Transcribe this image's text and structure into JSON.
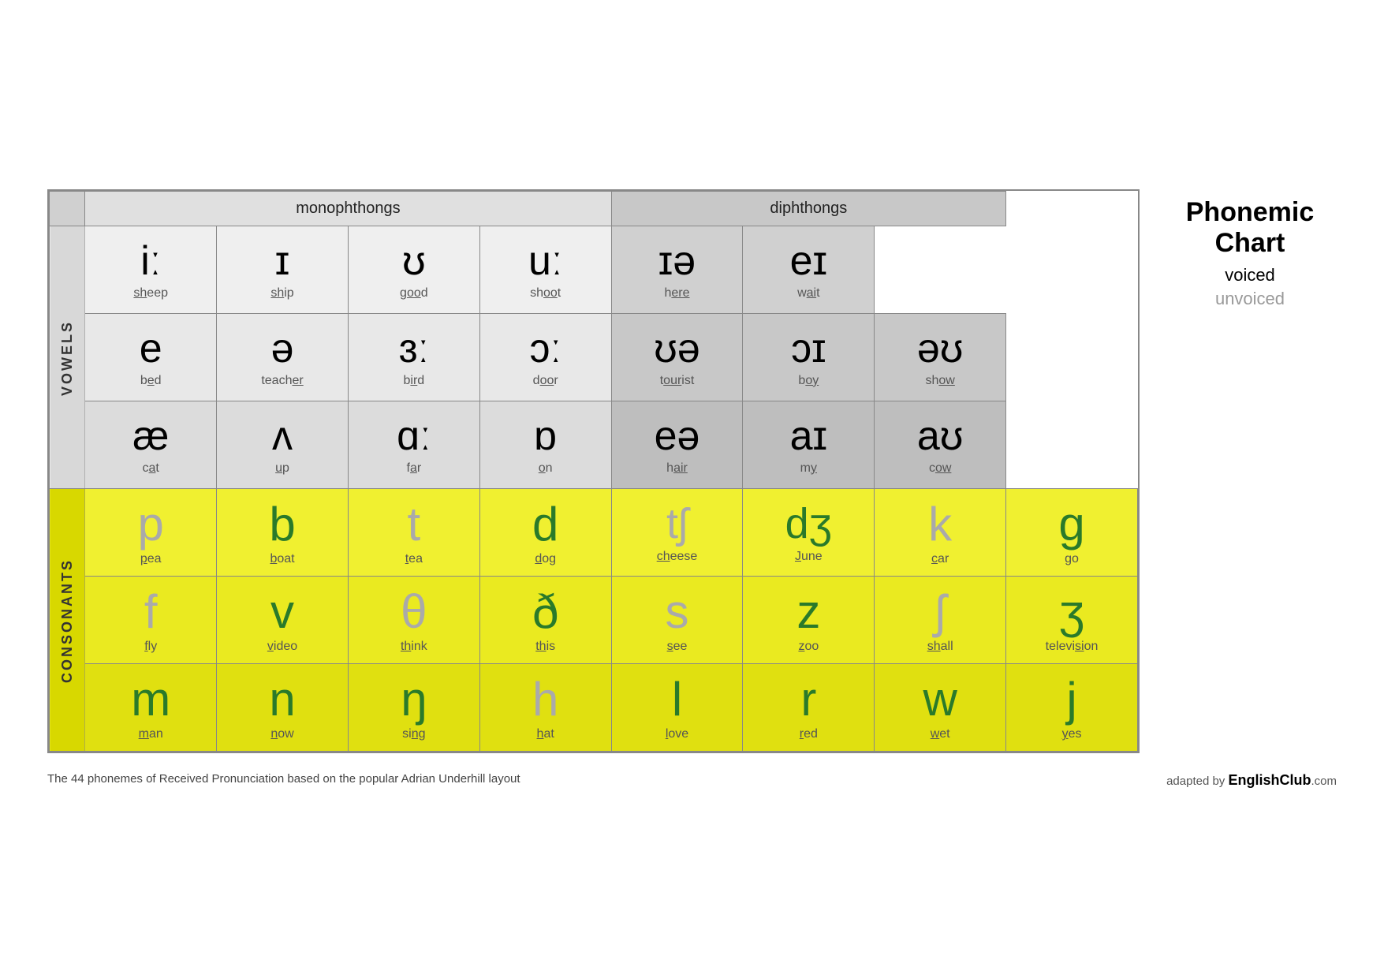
{
  "title": {
    "line1": "Phonemic",
    "line2": "Chart",
    "voiced": "voiced",
    "unvoiced": "unvoiced"
  },
  "headers": {
    "monophthongs": "monophthongs",
    "diphthongs": "diphthongs"
  },
  "labels": {
    "vowels": "VOWELS",
    "consonants": "CONSONANTS"
  },
  "vowel_rows": [
    {
      "cells": [
        {
          "ipa": "iː",
          "word": "sheep",
          "underline": "sh",
          "type": "mono"
        },
        {
          "ipa": "ɪ",
          "word": "ship",
          "underline": "sh",
          "type": "mono"
        },
        {
          "ipa": "ʊ",
          "word": "good",
          "underline": "oo",
          "type": "mono"
        },
        {
          "ipa": "uː",
          "word": "shoot",
          "underline": "oo",
          "type": "mono"
        },
        {
          "ipa": "ɪə",
          "word": "here",
          "underline": "ere",
          "type": "diph"
        },
        {
          "ipa": "eɪ",
          "word": "wait",
          "underline": "ai",
          "type": "diph"
        }
      ]
    },
    {
      "cells": [
        {
          "ipa": "e",
          "word": "bed",
          "underline": "e",
          "type": "mono"
        },
        {
          "ipa": "ə",
          "word": "teacher",
          "underline": "er",
          "type": "mono"
        },
        {
          "ipa": "ɜː",
          "word": "bird",
          "underline": "ir",
          "type": "mono"
        },
        {
          "ipa": "ɔː",
          "word": "door",
          "underline": "oo",
          "type": "mono"
        },
        {
          "ipa": "ʊə",
          "word": "tourist",
          "underline": "our",
          "type": "diph"
        },
        {
          "ipa": "ɔɪ",
          "word": "boy",
          "underline": "oy",
          "type": "diph"
        },
        {
          "ipa": "əʊ",
          "word": "show",
          "underline": "ow",
          "type": "diph"
        }
      ]
    },
    {
      "cells": [
        {
          "ipa": "æ",
          "word": "cat",
          "underline": "a",
          "type": "mono"
        },
        {
          "ipa": "ʌ",
          "word": "up",
          "underline": "u",
          "type": "mono"
        },
        {
          "ipa": "ɑː",
          "word": "far",
          "underline": "a",
          "type": "mono"
        },
        {
          "ipa": "ɒ",
          "word": "on",
          "underline": "o",
          "type": "mono"
        },
        {
          "ipa": "eə",
          "word": "hair",
          "underline": "air",
          "type": "diph"
        },
        {
          "ipa": "aɪ",
          "word": "my",
          "underline": "y",
          "type": "diph"
        },
        {
          "ipa": "aʊ",
          "word": "cow",
          "underline": "ow",
          "type": "diph"
        }
      ]
    }
  ],
  "consonant_rows": [
    {
      "cells": [
        {
          "ipa": "p",
          "word": "pea",
          "underline": "p",
          "voiced": false
        },
        {
          "ipa": "b",
          "word": "boat",
          "underline": "b",
          "voiced": true
        },
        {
          "ipa": "t",
          "word": "tea",
          "underline": "t",
          "voiced": false
        },
        {
          "ipa": "d",
          "word": "dog",
          "underline": "d",
          "voiced": true
        },
        {
          "ipa": "tʃ",
          "word": "cheese",
          "underline": "ch",
          "voiced": false
        },
        {
          "ipa": "dʒ",
          "word": "June",
          "underline": "J",
          "voiced": true
        },
        {
          "ipa": "k",
          "word": "car",
          "underline": "c",
          "voiced": false
        },
        {
          "ipa": "g",
          "word": "go",
          "underline": "g",
          "voiced": true
        }
      ]
    },
    {
      "cells": [
        {
          "ipa": "f",
          "word": "fly",
          "underline": "f",
          "voiced": false
        },
        {
          "ipa": "v",
          "word": "video",
          "underline": "v",
          "voiced": true
        },
        {
          "ipa": "θ",
          "word": "think",
          "underline": "th",
          "voiced": false
        },
        {
          "ipa": "ð",
          "word": "this",
          "underline": "th",
          "voiced": true
        },
        {
          "ipa": "s",
          "word": "see",
          "underline": "s",
          "voiced": false
        },
        {
          "ipa": "z",
          "word": "zoo",
          "underline": "z",
          "voiced": true
        },
        {
          "ipa": "ʃ",
          "word": "shall",
          "underline": "sh",
          "voiced": false
        },
        {
          "ipa": "ʒ",
          "word": "television",
          "underline": "si",
          "voiced": true
        }
      ]
    },
    {
      "cells": [
        {
          "ipa": "m",
          "word": "man",
          "underline": "m",
          "voiced": true
        },
        {
          "ipa": "n",
          "word": "now",
          "underline": "n",
          "voiced": true
        },
        {
          "ipa": "ŋ",
          "word": "sing",
          "underline": "ng",
          "voiced": true
        },
        {
          "ipa": "h",
          "word": "hat",
          "underline": "h",
          "voiced": false
        },
        {
          "ipa": "l",
          "word": "love",
          "underline": "l",
          "voiced": true
        },
        {
          "ipa": "r",
          "word": "red",
          "underline": "r",
          "voiced": true
        },
        {
          "ipa": "w",
          "word": "wet",
          "underline": "w",
          "voiced": true
        },
        {
          "ipa": "j",
          "word": "yes",
          "underline": "y",
          "voiced": true
        }
      ]
    }
  ],
  "footer": {
    "description": "The 44 phonemes of Received Pronunciation based on the popular Adrian Underhill layout",
    "credit_prefix": "adapted by ",
    "credit_brand": "EnglishClub",
    "credit_tld": ".com"
  }
}
